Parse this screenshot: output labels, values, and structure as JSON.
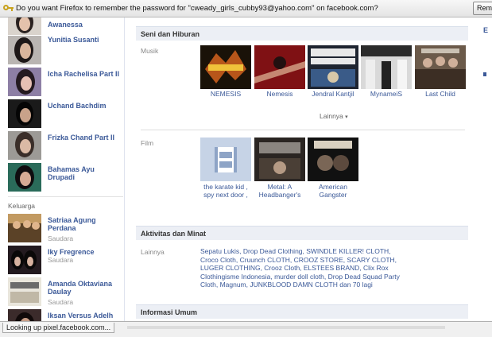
{
  "notification": {
    "message": "Do you want Firefox to remember the password for \"cweady_girls_cubby93@yahoo.com\" on facebook.com?",
    "button_label": "Rem"
  },
  "friends": [
    {
      "name": "Awanessa"
    },
    {
      "name": "Yunitia Susanti"
    },
    {
      "name": "Icha Rachelisa Part II"
    },
    {
      "name": "Uchand Bachdim"
    },
    {
      "name": "Frizka Chand Part II"
    },
    {
      "name": "Bahamas Ayu Drupadi"
    }
  ],
  "family_label": "Keluarga",
  "family": [
    {
      "name": "Satriaa Agung Perdana",
      "relation": "Saudara"
    },
    {
      "name": "Iky Fregrence",
      "relation": "Saudara"
    },
    {
      "name": "Amanda Oktaviana Daulay",
      "relation": "Saudara"
    },
    {
      "name": "Iksan Versus Adelh",
      "relation": ""
    }
  ],
  "sections": {
    "arts": "Seni dan Hiburan",
    "activities": "Aktivitas dan Minat",
    "general": "Informasi Umum"
  },
  "music": {
    "label": "Musik",
    "items": [
      {
        "caption": "NEMESIS"
      },
      {
        "caption": "Nemesis"
      },
      {
        "caption": "Jendral Kantjil"
      },
      {
        "caption": "MynameiS"
      },
      {
        "caption": "Last Child"
      }
    ],
    "more_label": "Lainnya",
    "more_arrow": "▾"
  },
  "film": {
    "label": "Film",
    "items": [
      {
        "caption_1": "the karate kid ,",
        "caption_2": "spy next door ,"
      },
      {
        "caption_1": "Metal: A",
        "caption_2": "Headbanger's"
      },
      {
        "caption_1": "American",
        "caption_2": "Gangster"
      }
    ]
  },
  "other": {
    "label": "Lainnya",
    "text": "Sepatu Lukis, Drop Dead Clothing, SWINDLE KILLER! CLOTH, Croco Cloth, Cruunch CLOTH, CROOZ STORE, SCARY CLOTH, LUGER CLOTHING, Crooz Cloth, ELSTEES BRAND, Clix Rox Clothingisme Indonesia, murder doll cloth, Drop Dead Squad Party Cloth, Magnum, JUNKBLOOD DAMN CLOTH dan 70 lagi"
  },
  "status_bar": {
    "text": "Looking up pixel.facebook.com..."
  },
  "colors": {
    "link": "#3b5998",
    "section_bg": "#eceff5"
  }
}
